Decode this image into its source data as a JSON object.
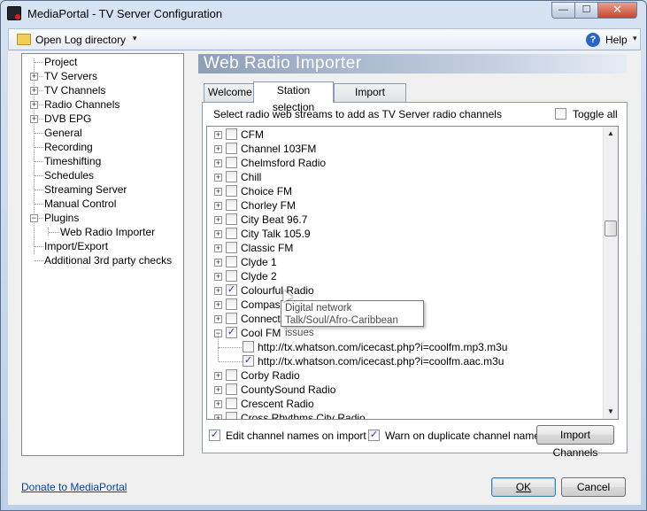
{
  "window": {
    "title": "MediaPortal - TV Server Configuration"
  },
  "titlebar_buttons": {
    "minimize": "—",
    "maximize": "☐",
    "close": "✕"
  },
  "toolbar": {
    "open_log": "Open Log directory",
    "help": "Help",
    "help_glyph": "?",
    "dropdown_glyph": "▾"
  },
  "tree": {
    "items": [
      {
        "label": "Project"
      },
      {
        "label": "TV Servers"
      },
      {
        "label": "TV Channels"
      },
      {
        "label": "Radio Channels"
      },
      {
        "label": "DVB EPG"
      },
      {
        "label": "General"
      },
      {
        "label": "Recording"
      },
      {
        "label": "Timeshifting"
      },
      {
        "label": "Schedules"
      },
      {
        "label": "Streaming Server"
      },
      {
        "label": "Manual Control"
      },
      {
        "label": "Plugins"
      },
      {
        "label": "Web Radio Importer"
      },
      {
        "label": "Import/Export"
      },
      {
        "label": "Additional 3rd party checks"
      }
    ]
  },
  "panel": {
    "header": "Web Radio Importer"
  },
  "tabs": [
    {
      "label": "Welcome"
    },
    {
      "label": "Station selection"
    },
    {
      "label": "Import progress"
    }
  ],
  "station_selection": {
    "instruction": "Select radio web streams to add as TV Server radio channels",
    "toggle_all": "Toggle all",
    "stations": [
      {
        "name": "CFM",
        "checked": false
      },
      {
        "name": "Channel 103FM",
        "checked": false
      },
      {
        "name": "Chelmsford Radio",
        "checked": false
      },
      {
        "name": "Chill",
        "checked": false
      },
      {
        "name": "Choice FM",
        "checked": false
      },
      {
        "name": "Chorley FM",
        "checked": false
      },
      {
        "name": "City Beat 96.7",
        "checked": false
      },
      {
        "name": "City Talk 105.9",
        "checked": false
      },
      {
        "name": "Classic FM",
        "checked": false
      },
      {
        "name": "Clyde 1",
        "checked": false
      },
      {
        "name": "Clyde 2",
        "checked": false
      },
      {
        "name": "Colourful Radio",
        "checked": true
      },
      {
        "name": "Compass",
        "checked": false
      },
      {
        "name": "Connect",
        "checked": false
      },
      {
        "name": "Cool FM",
        "checked": true
      },
      {
        "name": "http://tx.whatson.com/icecast.php?i=coolfm.mp3.m3u",
        "checked": false,
        "child": true
      },
      {
        "name": "http://tx.whatson.com/icecast.php?i=coolfm.aac.m3u",
        "checked": true,
        "child": true
      },
      {
        "name": "Corby Radio",
        "checked": false
      },
      {
        "name": "CountySound Radio",
        "checked": false
      },
      {
        "name": "Crescent Radio",
        "checked": false
      },
      {
        "name": "Cross Rhythms City Radio",
        "checked": false
      }
    ],
    "tooltip": {
      "line1": "Digital network",
      "line2": "Talk/Soul/Afro-Caribbean issues"
    },
    "edit_names": {
      "label": "Edit channel names on import",
      "checked": true
    },
    "warn_duplicate": {
      "label": "Warn on duplicate channel name",
      "checked": true
    },
    "import_button": "Import Channels"
  },
  "footer": {
    "donate": "Donate to MediaPortal",
    "ok": "OK",
    "cancel": "Cancel"
  },
  "glyphs": {
    "check": "✓",
    "plus": "+",
    "minus": "−",
    "scroll_up": "▲",
    "scroll_down": "▼"
  }
}
